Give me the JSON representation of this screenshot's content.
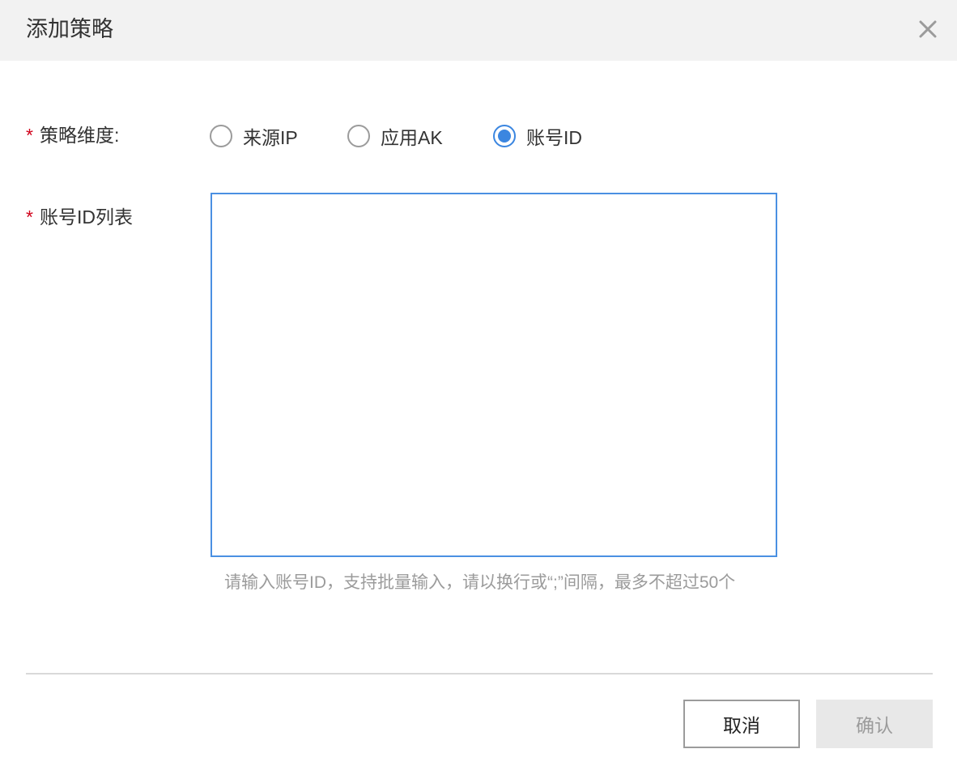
{
  "dialog": {
    "title": "添加策略",
    "close_icon": "close-icon"
  },
  "form": {
    "dimension": {
      "required_mark": "*",
      "label": "策略维度:",
      "options": [
        {
          "label": "来源IP",
          "checked": false
        },
        {
          "label": "应用AK",
          "checked": false
        },
        {
          "label": "账号ID",
          "checked": true
        }
      ]
    },
    "id_list": {
      "required_mark": "*",
      "label": "账号ID列表",
      "value": "",
      "hint": "请输入账号ID，支持批量输入，请以换行或“;”间隔，最多不超过50个"
    }
  },
  "footer": {
    "cancel_label": "取消",
    "confirm_label": "确认"
  },
  "colors": {
    "header_bg": "#f2f2f2",
    "accent": "#3b86e0",
    "textarea_border": "#4a90e2",
    "required": "#d0021b",
    "hint_text": "#9b9b9b",
    "disabled_button_bg": "#e8e8e8"
  }
}
